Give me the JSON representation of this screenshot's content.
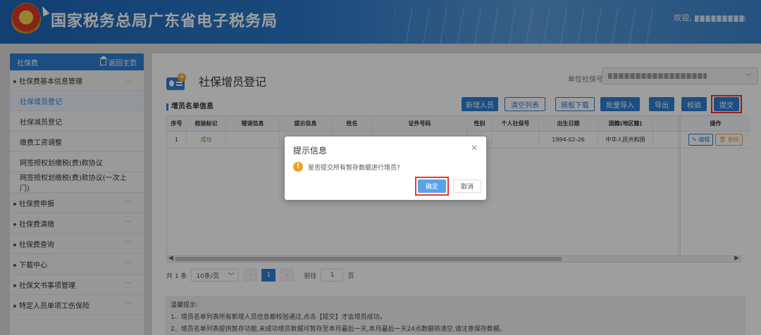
{
  "header": {
    "emblem_text": "广东税务",
    "title": "国家税务总局广东省电子税务局",
    "welcome": "欢迎,"
  },
  "sidebar": {
    "head_label": "社保费",
    "home_label": "返回主页",
    "items": [
      {
        "label": "社保费基本信息管理"
      },
      {
        "label": "社保增员登记"
      },
      {
        "label": "社保减员登记"
      },
      {
        "label": "缴费工资调整"
      },
      {
        "label": "网签授权划缴税(费)款协议"
      },
      {
        "label": "网签授权划缴税(费)款协议(一次上门)"
      },
      {
        "label": "社保费申报"
      },
      {
        "label": "社保费清缴"
      },
      {
        "label": "社保费查询"
      },
      {
        "label": "下载中心"
      },
      {
        "label": "社保文书事项管理"
      },
      {
        "label": "特定人员单项工伤保险"
      }
    ]
  },
  "main": {
    "page_title": "社保增员登记",
    "unit_label": "单位社保号:",
    "section_title": "增员名单信息",
    "buttons": {
      "add": "新增人员",
      "clear": "清空列表",
      "template": "模板下载",
      "import": "批量导入",
      "export": "导出",
      "verify": "校验",
      "submit": "提交"
    },
    "table": {
      "columns": [
        "序号",
        "校验标记",
        "错误信息",
        "提示信息",
        "姓名",
        "证件号码",
        "性别",
        "个人社保号",
        "出生日期",
        "国籍(地区籍)",
        "操作"
      ],
      "rows": [
        {
          "index": "1",
          "mark": "成功",
          "error": "",
          "hint": "",
          "name": "",
          "id": "",
          "gender": "",
          "ssn": "",
          "birth": "1994-02-26",
          "nation": "中华人民共和国"
        }
      ],
      "edit_label": "编辑",
      "delete_label": "删除"
    },
    "pager": {
      "total": "共 1 条",
      "size": "10条/页",
      "current": "1",
      "goto_prefix": "前往",
      "goto_value": "1",
      "goto_suffix": "页"
    },
    "tips": {
      "heading": "温馨提示:",
      "line1": "1、增员名单列表所有新增人员信息都校验通过,点击【提交】才会增员成功。",
      "line2": "2、增员名单列表提供暂存功能,未成功增员数据可暂存至本月最后一天,本月最后一天24点数据将清空,请注意保存数据。"
    }
  },
  "dialog": {
    "title": "提示信息",
    "message": "是否提交所有暂存数据进行增员?",
    "ok": "确定",
    "cancel": "取消"
  },
  "colors": {
    "primary": "#2d7fd3",
    "header_blue": "#2a78c9",
    "success": "#3cb034",
    "warning": "#f0a020",
    "highlight_red": "#e33333"
  }
}
